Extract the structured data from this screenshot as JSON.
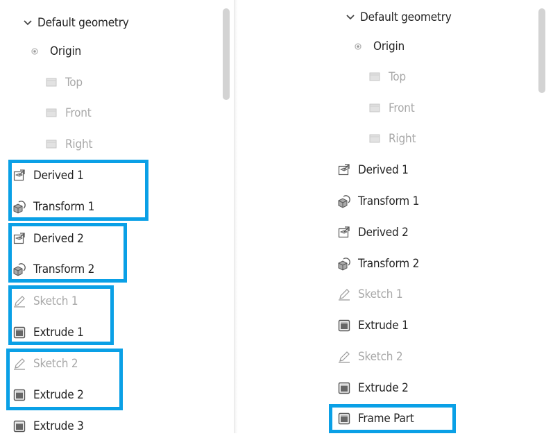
{
  "left": {
    "items": [
      {
        "label": "Default geometry",
        "icon": "chevron-down-icon"
      },
      {
        "label": "Origin",
        "icon": "origin-icon"
      },
      {
        "label": "Top",
        "icon": "plane-icon"
      },
      {
        "label": "Front",
        "icon": "plane-icon"
      },
      {
        "label": "Right",
        "icon": "plane-icon"
      },
      {
        "label": "Derived 1",
        "icon": "derived-icon"
      },
      {
        "label": "Transform 1",
        "icon": "transform-icon"
      },
      {
        "label": "Derived 2",
        "icon": "derived-icon"
      },
      {
        "label": "Transform 2",
        "icon": "transform-icon"
      },
      {
        "label": "Sketch 1",
        "icon": "sketch-icon"
      },
      {
        "label": "Extrude 1",
        "icon": "extrude-icon"
      },
      {
        "label": "Sketch 2",
        "icon": "sketch-icon"
      },
      {
        "label": "Extrude 2",
        "icon": "extrude-icon"
      },
      {
        "label": "Extrude 3",
        "icon": "extrude-icon"
      }
    ]
  },
  "right": {
    "items": [
      {
        "label": "Default geometry",
        "icon": "chevron-down-icon"
      },
      {
        "label": "Origin",
        "icon": "origin-icon"
      },
      {
        "label": "Top",
        "icon": "plane-icon"
      },
      {
        "label": "Front",
        "icon": "plane-icon"
      },
      {
        "label": "Right",
        "icon": "plane-icon"
      },
      {
        "label": "Derived 1",
        "icon": "derived-icon"
      },
      {
        "label": "Transform 1",
        "icon": "transform-icon"
      },
      {
        "label": "Derived 2",
        "icon": "derived-icon"
      },
      {
        "label": "Transform 2",
        "icon": "transform-icon"
      },
      {
        "label": "Sketch 1",
        "icon": "sketch-icon"
      },
      {
        "label": "Extrude 1",
        "icon": "extrude-icon"
      },
      {
        "label": "Sketch 2",
        "icon": "sketch-icon"
      },
      {
        "label": "Extrude 2",
        "icon": "extrude-icon"
      },
      {
        "label": "Frame Part",
        "icon": "extrude-icon"
      }
    ]
  },
  "colors": {
    "highlight": "#0aa0e6",
    "text": "#222222",
    "dim_text": "#a8a8a8"
  }
}
